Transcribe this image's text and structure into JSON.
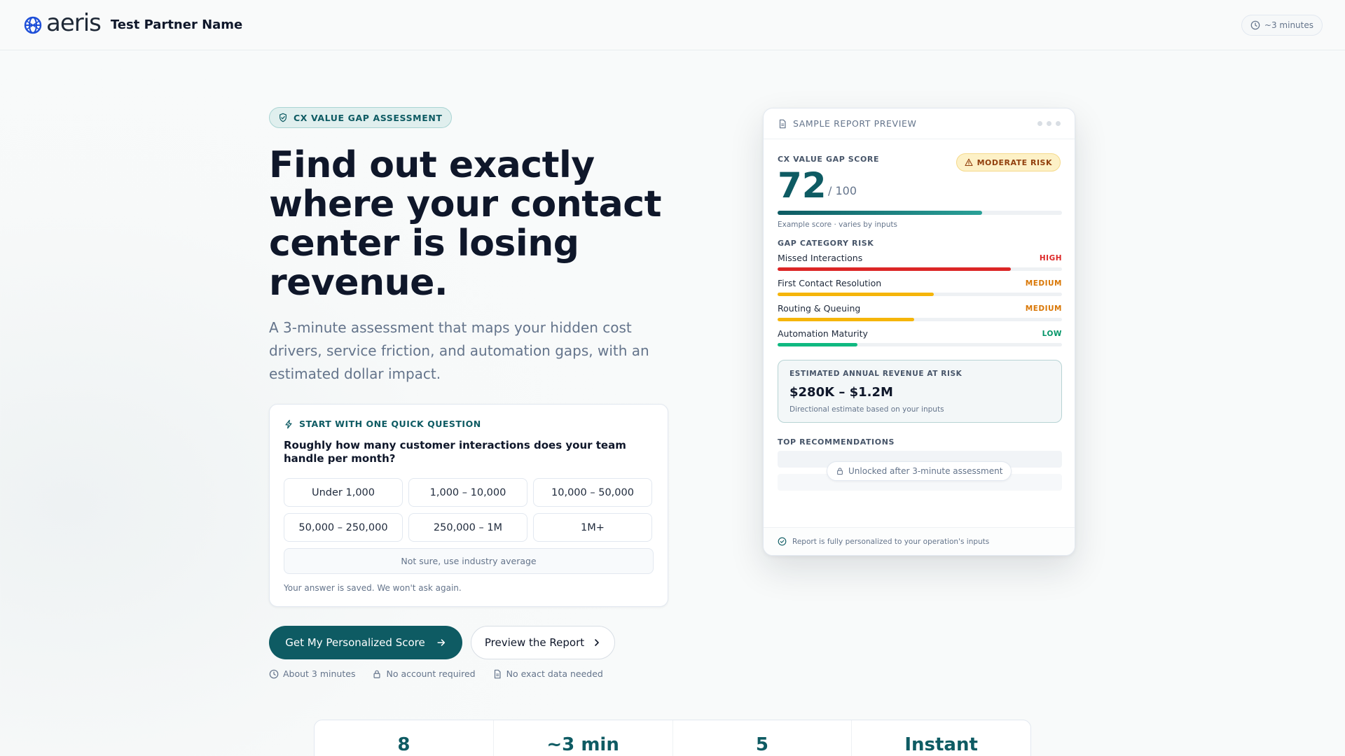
{
  "header": {
    "logo_text": "aeris",
    "partner_name": "Test Partner Name",
    "time_estimate": "~3 minutes",
    "brand_color": "#0e5b63"
  },
  "hero": {
    "badge": "CX VALUE GAP ASSESSMENT",
    "title": "Find out exactly where your contact center is losing revenue.",
    "subtitle": "A 3-minute assessment that maps your hidden cost drivers, service friction, and automation gaps, with an estimated dollar impact."
  },
  "question": {
    "kicker": "START WITH ONE QUICK QUESTION",
    "text": "Roughly how many customer interactions does your team handle per month?",
    "options": [
      "Under 1,000",
      "1,000 – 10,000",
      "10,000 – 50,000",
      "50,000 – 250,000",
      "250,000 – 1M",
      "1M+"
    ],
    "unsure_option": "Not sure, use industry average",
    "saved_note": "Your answer is saved. We won't ask again."
  },
  "cta": {
    "primary": "Get My Personalized Score",
    "secondary": "Preview the Report"
  },
  "reassurance": [
    "About 3 minutes",
    "No account required",
    "No exact data needed"
  ],
  "preview": {
    "header": "SAMPLE REPORT PREVIEW",
    "score_label": "CX VALUE GAP SCORE",
    "risk_badge": "MODERATE RISK",
    "score": "72",
    "score_max": "/ 100",
    "score_fraction": 0.72,
    "score_note": "Example score · varies by inputs",
    "gap_label": "GAP CATEGORY RISK",
    "gaps": [
      {
        "name": "Missed Interactions",
        "level": "HIGH",
        "fraction": 0.82,
        "color": "#dc2626"
      },
      {
        "name": "First Contact Resolution",
        "level": "MEDIUM",
        "fraction": 0.55,
        "color": "#f5b50a"
      },
      {
        "name": "Routing & Queuing",
        "level": "MEDIUM",
        "fraction": 0.48,
        "color": "#f5b50a"
      },
      {
        "name": "Automation Maturity",
        "level": "LOW",
        "fraction": 0.28,
        "color": "#10b981"
      }
    ],
    "level_colors": {
      "HIGH": "#dc2626",
      "MEDIUM": "#d97706",
      "LOW": "#059669"
    },
    "revenue_label": "ESTIMATED ANNUAL REVENUE AT RISK",
    "revenue_value": "$280K – $1.2M",
    "revenue_note": "Directional estimate based on your inputs",
    "rec_label": "TOP RECOMMENDATIONS",
    "unlock_text": "Unlocked after 3-minute assessment",
    "footer": "Report is fully personalized to your operation's inputs"
  },
  "stats": [
    "8",
    "~3 min",
    "5",
    "Instant"
  ]
}
